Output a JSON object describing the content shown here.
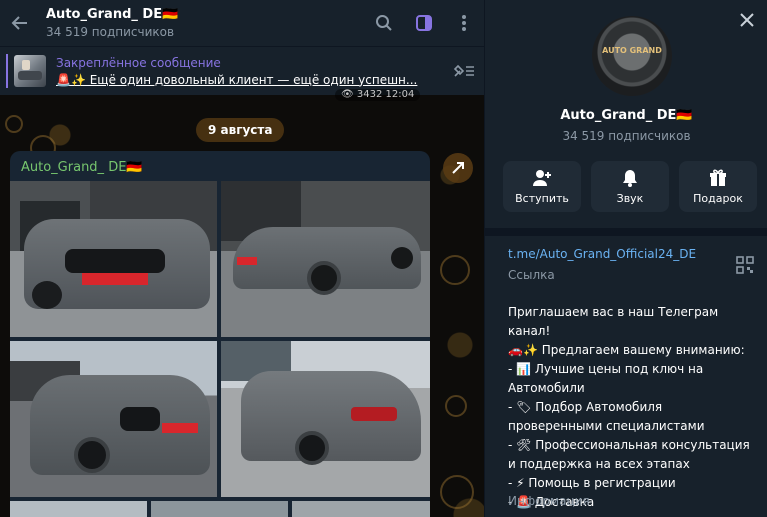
{
  "chat": {
    "title": "Auto_Grand_ DE🇩🇪",
    "subtitle": "34 519 подписчиков",
    "pinned_title": "Закреплённое сообщение",
    "pinned_text": "🚨✨ Ещё один довольный клиент — ещё один успешн...",
    "prev_meta": "👁 3432 12:04",
    "date_pill": "9 августа",
    "post_author": "Auto_Grand_ DE🇩🇪",
    "icons": [
      "back-arrow-icon",
      "search-icon",
      "sidebar-toggle-icon",
      "more-vertical-icon",
      "unpin-icon",
      "forward-icon"
    ]
  },
  "panel": {
    "avatar_text": "AUTO GRAND",
    "name": "Auto_Grand_ DE🇩🇪",
    "subscribers": "34 519 подписчиков",
    "actions": [
      {
        "label": "Вступить",
        "icon": "add-user-icon"
      },
      {
        "label": "Звук",
        "icon": "bell-icon"
      },
      {
        "label": "Подарок",
        "icon": "gift-icon"
      }
    ],
    "link": "t.me/Auto_Grand_Official24_DE",
    "link_label": "Ссылка",
    "description": [
      "Приглашаем вас в наш Телеграм канал!",
      "🚗✨ Предлагаем вашему вниманию:",
      "- 📊 Лучшие цены под ключ на",
      "Автомобили",
      "- 🏷 Подбор Автомобиля",
      "проверенными специалистами",
      "- 🛠 Профессиональная консультация",
      "и поддержка на всех этапах",
      "- ⚡ Помощь в регистрации",
      "- 🚨 Доставка"
    ],
    "info_label": "Информация"
  },
  "colors": {
    "accent": "#8774e1",
    "link": "#6ab2f2",
    "author": "#77c66e",
    "panel_bg": "#17212b",
    "bubble_bg": "#182533"
  }
}
